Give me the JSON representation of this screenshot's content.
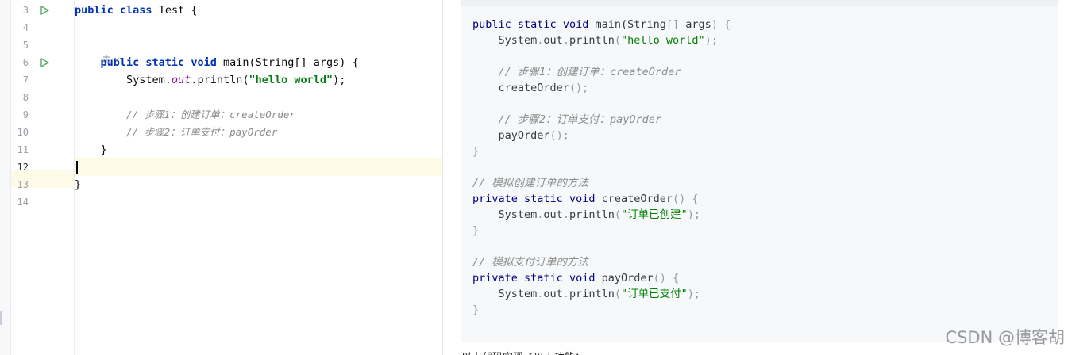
{
  "editor": {
    "lines": [
      {
        "no": "3",
        "run": true,
        "tokens": [
          [
            "kw",
            "public "
          ],
          [
            "kw",
            "class "
          ],
          [
            "txt",
            "Test {"
          ]
        ]
      },
      {
        "no": "4",
        "run": false,
        "tokens": []
      },
      {
        "no": "5",
        "run": false,
        "tokens": []
      },
      {
        "no": "6",
        "run": true,
        "tokens": [
          [
            "txt",
            "    "
          ],
          [
            "kw",
            "public "
          ],
          [
            "kw",
            "static "
          ],
          [
            "kw",
            "void "
          ],
          [
            "txt",
            "main(String[] args) {"
          ]
        ]
      },
      {
        "no": "7",
        "run": false,
        "tokens": [
          [
            "txt",
            "        System."
          ],
          [
            "fld",
            "out"
          ],
          [
            "txt",
            ".println("
          ],
          [
            "str",
            "\"hello world\""
          ],
          [
            "txt",
            ");"
          ]
        ]
      },
      {
        "no": "8",
        "run": false,
        "tokens": []
      },
      {
        "no": "9",
        "run": false,
        "tokens": [
          [
            "txt",
            "        "
          ],
          [
            "cmt",
            "// 步骤1：创建订单：createOrder"
          ]
        ]
      },
      {
        "no": "10",
        "run": false,
        "tokens": [
          [
            "txt",
            "        "
          ],
          [
            "cmt",
            "// 步骤2：订单支付：payOrder"
          ]
        ]
      },
      {
        "no": "11",
        "run": false,
        "tokens": [
          [
            "txt",
            "    }"
          ]
        ]
      },
      {
        "no": "12",
        "run": false,
        "current": true,
        "tokens": []
      },
      {
        "no": "13",
        "run": false,
        "tokens": [
          [
            "txt",
            "}"
          ]
        ]
      },
      {
        "no": "14",
        "run": false,
        "tokens": []
      }
    ],
    "run_icon_name": "run-gutter-icon",
    "lens_icon_name": "ai-lens-icon"
  },
  "article": {
    "code_lines": [
      [
        [
          "b-kw",
          "public "
        ],
        [
          "b-kw",
          "static "
        ],
        [
          "b-kw",
          "void "
        ],
        [
          "b-def",
          "main"
        ],
        [
          "b-def",
          "(String"
        ],
        [
          "b-punc",
          "[] "
        ],
        [
          "b-def",
          "args"
        ],
        [
          "b-punc",
          ") {"
        ]
      ],
      [
        [
          "b-def",
          "    System"
        ],
        [
          "b-punc",
          "."
        ],
        [
          "b-def",
          "out"
        ],
        [
          "b-punc",
          "."
        ],
        [
          "b-def",
          "println"
        ],
        [
          "b-punc",
          "("
        ],
        [
          "b-str",
          "\"hello world\""
        ],
        [
          "b-punc",
          ");"
        ]
      ],
      [],
      [
        [
          "b-cmt",
          "    // 步骤1：创建订单：createOrder"
        ]
      ],
      [
        [
          "b-def",
          "    createOrder"
        ],
        [
          "b-punc",
          "();"
        ]
      ],
      [],
      [
        [
          "b-cmt",
          "    // 步骤2：订单支付：payOrder"
        ]
      ],
      [
        [
          "b-def",
          "    payOrder"
        ],
        [
          "b-punc",
          "();"
        ]
      ],
      [
        [
          "b-punc",
          "}"
        ]
      ],
      [],
      [
        [
          "b-cmt",
          "// 模拟创建订单的方法"
        ]
      ],
      [
        [
          "b-kw",
          "private "
        ],
        [
          "b-kw",
          "static "
        ],
        [
          "b-kw",
          "void "
        ],
        [
          "b-def",
          "createOrder"
        ],
        [
          "b-punc",
          "() {"
        ]
      ],
      [
        [
          "b-def",
          "    System"
        ],
        [
          "b-punc",
          "."
        ],
        [
          "b-def",
          "out"
        ],
        [
          "b-punc",
          "."
        ],
        [
          "b-def",
          "println"
        ],
        [
          "b-punc",
          "("
        ],
        [
          "b-str",
          "\"订单已创建\""
        ],
        [
          "b-punc",
          ");"
        ]
      ],
      [
        [
          "b-punc",
          "}"
        ]
      ],
      [],
      [
        [
          "b-cmt",
          "// 模拟支付订单的方法"
        ]
      ],
      [
        [
          "b-kw",
          "private "
        ],
        [
          "b-kw",
          "static "
        ],
        [
          "b-kw",
          "void "
        ],
        [
          "b-def",
          "payOrder"
        ],
        [
          "b-punc",
          "() {"
        ]
      ],
      [
        [
          "b-def",
          "    System"
        ],
        [
          "b-punc",
          "."
        ],
        [
          "b-def",
          "out"
        ],
        [
          "b-punc",
          "."
        ],
        [
          "b-def",
          "println"
        ],
        [
          "b-punc",
          "("
        ],
        [
          "b-str",
          "\"订单已支付\""
        ],
        [
          "b-punc",
          ");"
        ]
      ],
      [
        [
          "b-punc",
          "}"
        ]
      ]
    ],
    "below_text": "以上代码实现了以下功能：",
    "watermark": "CSDN @博客胡"
  },
  "colors": {
    "current_line": "#fdfbe8",
    "run_icon": "#59a869",
    "keyword": "#0033b3",
    "string": "#067d17",
    "codeblock_bg": "#f6f8fa"
  }
}
